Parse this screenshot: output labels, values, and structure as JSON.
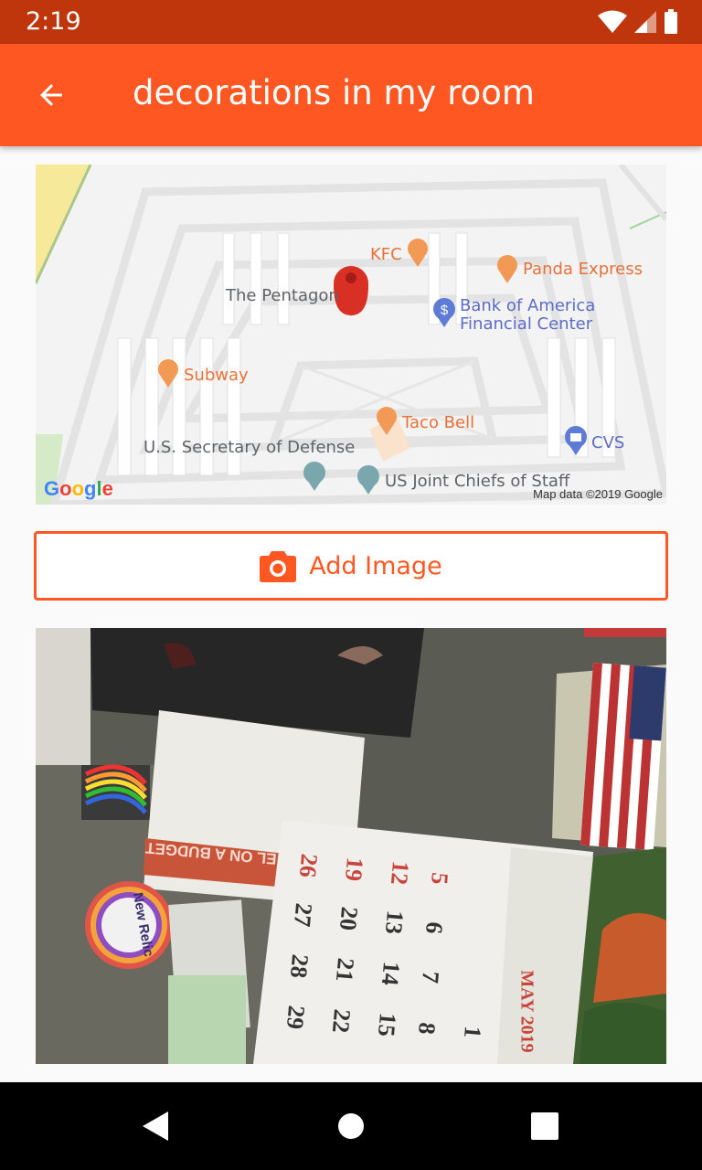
{
  "status_bar": {
    "time": "2:19"
  },
  "app_bar": {
    "title": "decorations in my room",
    "back_icon": "arrow-back-icon"
  },
  "map": {
    "labels": {
      "kfc": "KFC",
      "panda": "Panda Express",
      "pentagon": "The Pentagon",
      "boa_line1": "Bank of America",
      "boa_line2": "Financial Center",
      "subway": "Subway",
      "tacobell": "Taco Bell",
      "cvs": "CVS",
      "secdef": "U.S. Secretary of Defense",
      "joint": "US Joint Chiefs of Staff"
    },
    "logo": "Google",
    "attribution": "Map data ©2019 Google",
    "colors": {
      "food": "#f29a55",
      "bank": "#5e7bd6",
      "pin": "#d93025"
    }
  },
  "add_image": {
    "label": "Add Image",
    "icon": "camera-icon",
    "accent": "#ff5722"
  },
  "photo": {
    "budget_text": "EL ON A BUDGET",
    "sticker_text": "New Relic",
    "calendar_month": "MAY 2019",
    "calendar_days": [
      [
        "26",
        "19",
        "12",
        "5"
      ],
      [
        "27",
        "20",
        "13",
        "6"
      ],
      [
        "28",
        "21",
        "14",
        "7"
      ],
      [
        "29",
        "22",
        "15",
        "8",
        "1"
      ]
    ]
  },
  "nav_bar": {
    "back": "nav-back-icon",
    "home": "nav-home-icon",
    "recents": "nav-recents-icon"
  }
}
